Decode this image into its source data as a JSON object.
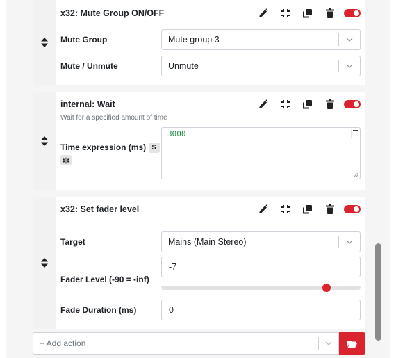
{
  "colors": {
    "accent": "#d9232d",
    "panel": "#f5f5f5",
    "textarea_text": "#2a8a48"
  },
  "actions": [
    {
      "title": "x32: Mute Group ON/OFF",
      "fields": [
        {
          "label": "Mute Group",
          "value": "Mute group 3"
        },
        {
          "label": "Mute / Unmute",
          "value": "Unmute"
        }
      ]
    },
    {
      "title": "internal: Wait",
      "description": "Wait for a specified amount of time",
      "field_label": "Time expression (ms)",
      "chip": "$",
      "value": "3000"
    },
    {
      "title": "x32: Set fader level",
      "target_label": "Target",
      "target_value": "Mains (Main Stereo)",
      "fader_label": "Fader Level (-90 = -inf)",
      "fader_value": "-7",
      "fader_min": -90,
      "fader_max": 10,
      "duration_label": "Fade Duration (ms)",
      "duration_value": "0"
    }
  ],
  "add_action": {
    "placeholder": "+ Add action"
  },
  "icons": {
    "handle": "sort-handle-icon",
    "edit": "pencil-icon",
    "collapse": "compress-icon",
    "duplicate": "copy-icon",
    "delete": "trash-icon",
    "toggle": "toggle-switch",
    "globe": "globe-icon",
    "chevron": "chevron-down-icon",
    "folder": "folder-open-icon"
  }
}
